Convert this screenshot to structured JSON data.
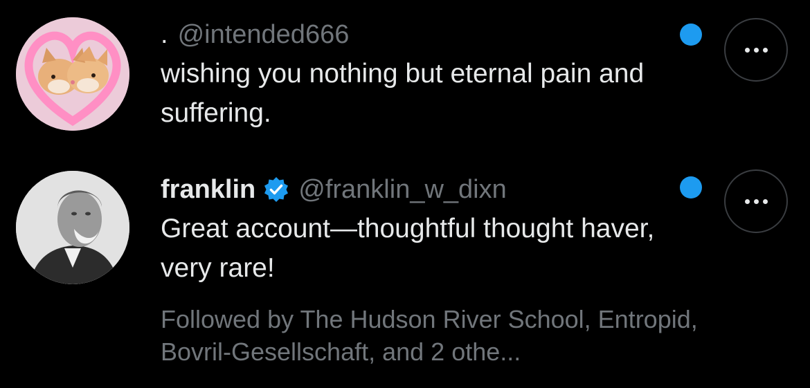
{
  "colors": {
    "background": "#000000",
    "text_primary": "#e7e9ea",
    "text_secondary": "#71767b",
    "accent_blue": "#1d9bf0",
    "button_border": "#3a3d41"
  },
  "items": [
    {
      "avatar_icon": "kittens-avatar",
      "display_name": ".",
      "handle": "@intended666",
      "verified": false,
      "body": "wishing you nothing but eternal pain and suffering.",
      "unread": true,
      "more_icon": "more-horizontal-icon"
    },
    {
      "avatar_icon": "portrait-avatar",
      "display_name": "franklin",
      "handle": "@franklin_w_dixn",
      "verified": true,
      "verified_icon": "verified-badge-icon",
      "body": "Great account—thoughtful thought haver, very rare!",
      "followed_by": "Followed by The Hudson River School, Entropid, Bovril-Gesellschaft, and 2 othe...",
      "unread": true,
      "more_icon": "more-horizontal-icon"
    }
  ]
}
